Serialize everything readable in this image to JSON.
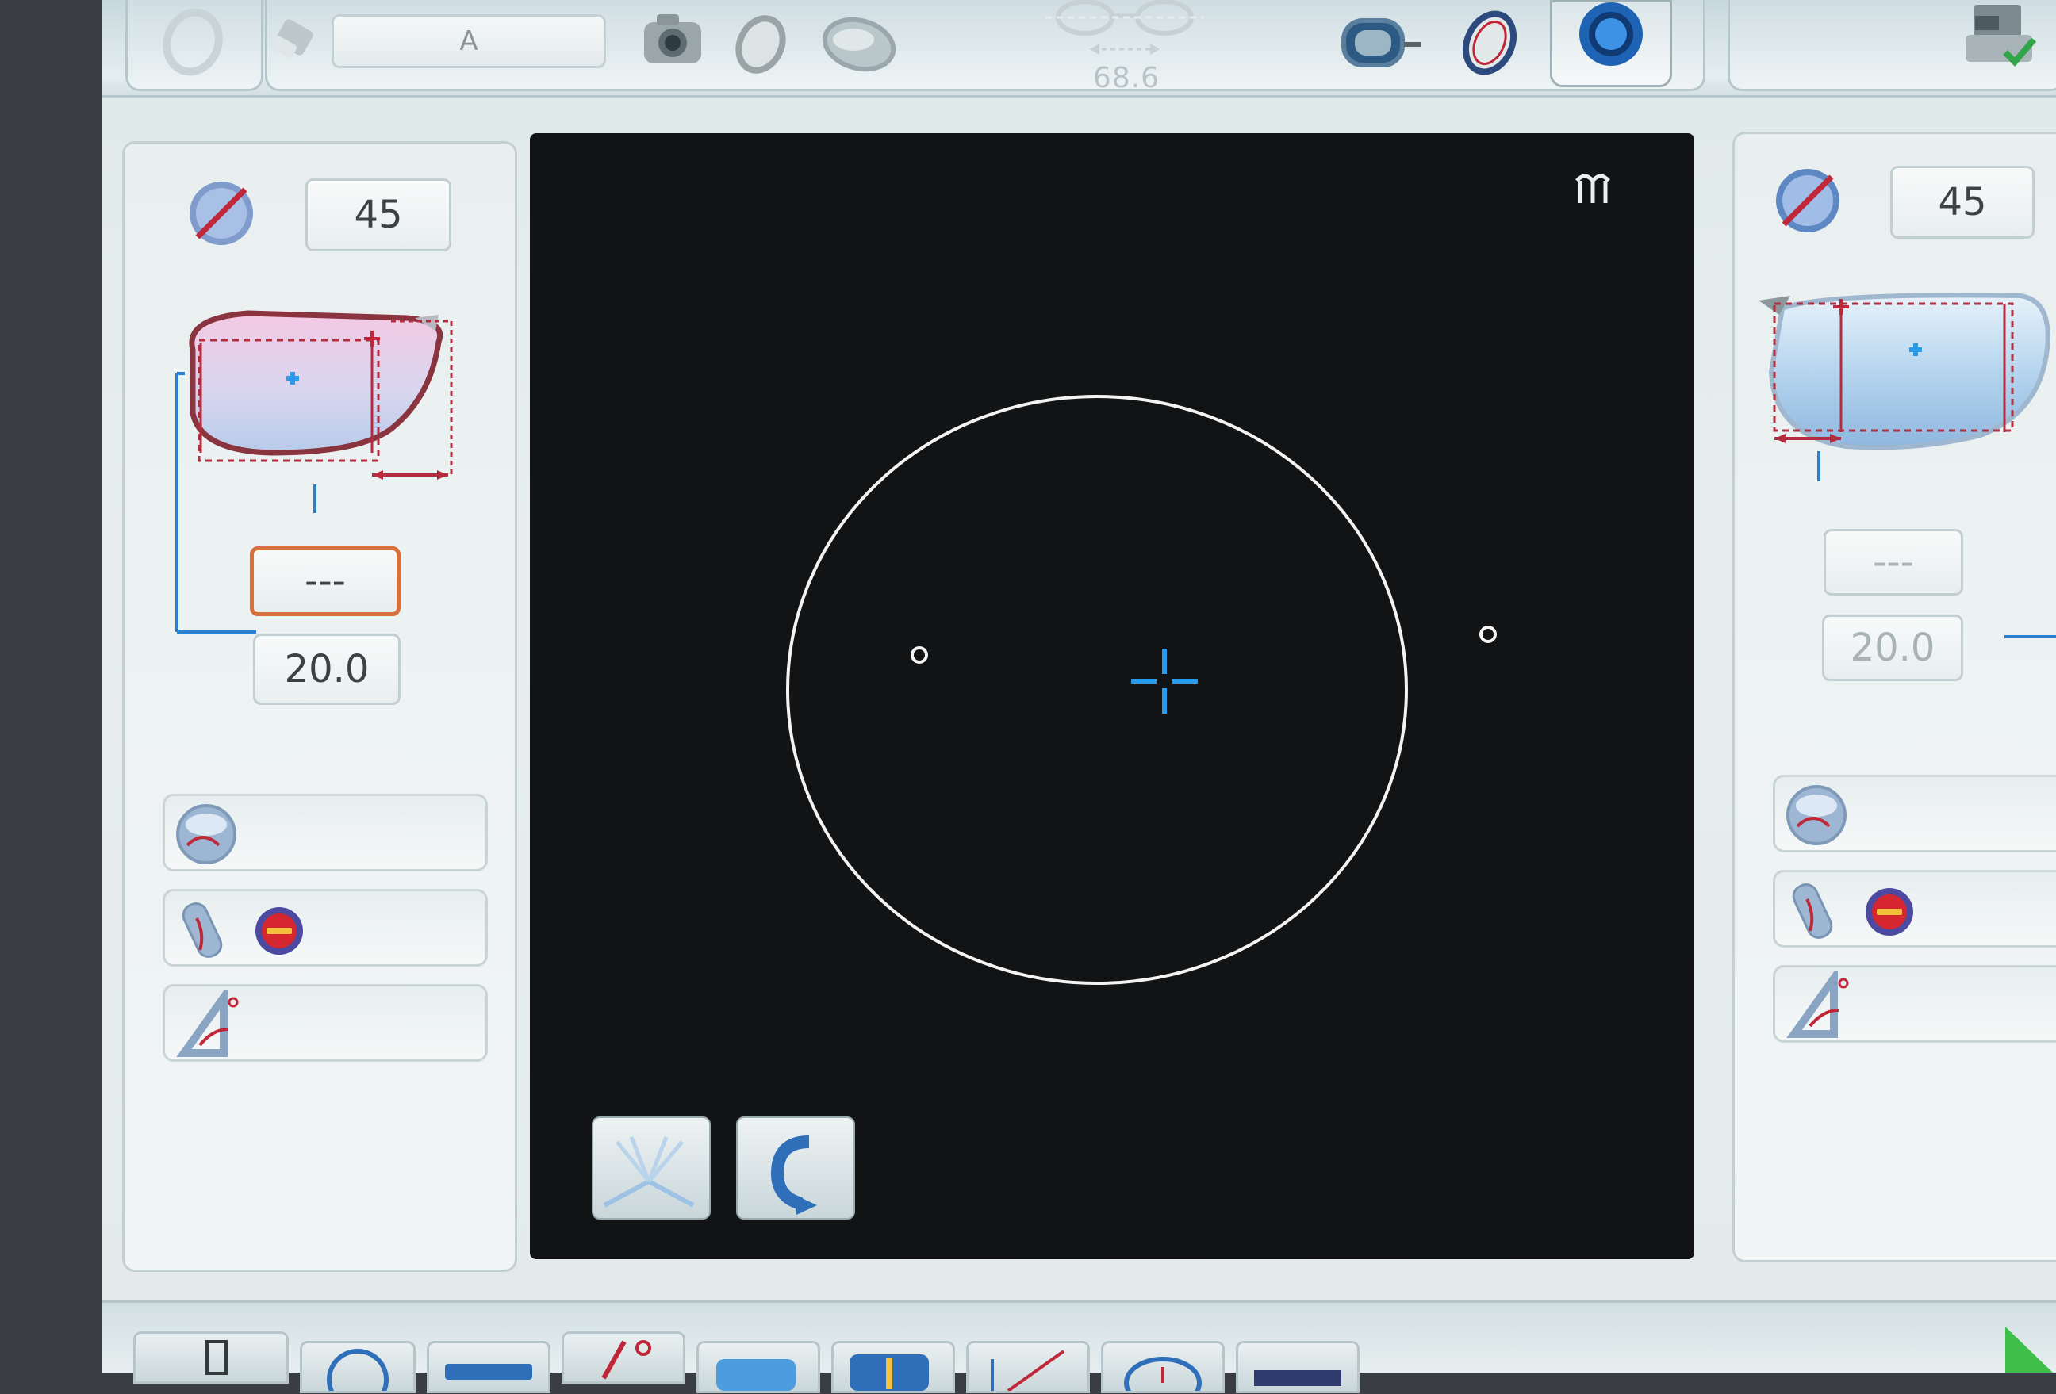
{
  "toolbar": {
    "job_field": "A",
    "pd_value": "68.6"
  },
  "left_panel": {
    "angle_value": "45",
    "field_value": "---",
    "height_value": "20.0"
  },
  "right_panel": {
    "angle_value": "45",
    "field_value": "---",
    "height_value": "20.0"
  },
  "display": {
    "corner_icon": "lens-tracer-icon",
    "shape": "oval-lens-trace",
    "center_marker": "blue-crosshair"
  },
  "colors": {
    "accent_blue": "#2a9be8",
    "active_field_border": "#d8703e",
    "trace_line": "#ffffff",
    "display_background": "#121314",
    "lens_marker_red": "#c0283a"
  }
}
